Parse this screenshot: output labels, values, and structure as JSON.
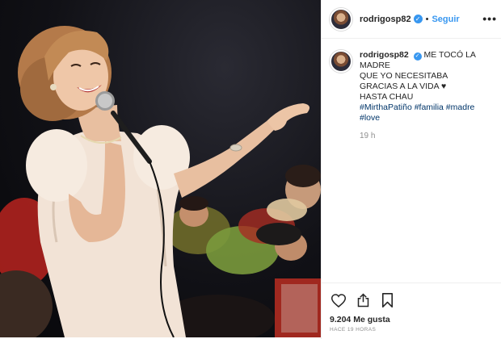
{
  "post": {
    "username": "rodrigosp82",
    "separator": "•",
    "follow_label": "Seguir",
    "more_label": "•••",
    "verified_mark": "✓",
    "caption": {
      "line1": "ME TOCÓ LA MADRE",
      "line2": "QUE YO NECESITABA",
      "line3": "GRACIAS A LA VIDA ♥",
      "line4": "HASTA CHAU",
      "hashtags": "#MirthaPatiño #familia #madre #love"
    },
    "time_ago": "19 h",
    "likes": "9.204 Me gusta",
    "timestamp": "HACE 19 HORAS"
  },
  "icons": {
    "like": "heart-icon",
    "share": "share-icon",
    "save": "bookmark-icon",
    "verified": "verified-badge-icon",
    "more": "more-options-icon"
  },
  "colors": {
    "link_blue": "#3897f0",
    "hashtag_blue": "#003569",
    "muted_gray": "#8e8e8e",
    "text": "#262626",
    "border": "#efefef"
  }
}
